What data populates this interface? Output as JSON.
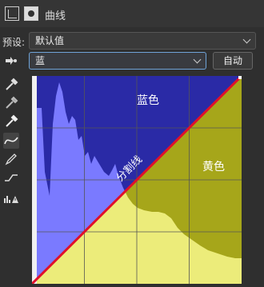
{
  "header": {
    "title": "曲线"
  },
  "preset": {
    "label": "预设:",
    "value": "默认值"
  },
  "channel": {
    "value": "蓝",
    "auto_label": "自动"
  },
  "graph": {
    "blue_region_label": "蓝色",
    "yellow_region_label": "黄色",
    "divider_label": "分割线"
  },
  "colors": {
    "blue_region": "#2a2aa6",
    "yellow_region": "#a6a61a",
    "histogram_blue": "#7a7aff",
    "histogram_yellow": "#ecec7a",
    "curve_line": "#e0102a"
  }
}
